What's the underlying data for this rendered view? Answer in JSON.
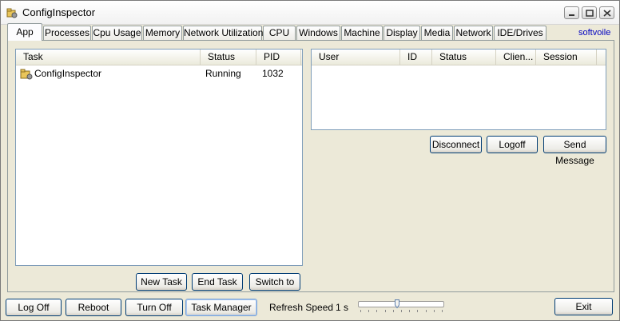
{
  "window": {
    "title": "ConfigInspector",
    "icon": "folder-gear-icon"
  },
  "tabs": [
    {
      "label": "App",
      "active": true
    },
    {
      "label": "Processes"
    },
    {
      "label": "Cpu Usage"
    },
    {
      "label": "Memory"
    },
    {
      "label": "Network Utilization"
    },
    {
      "label": "CPU"
    },
    {
      "label": "Windows"
    },
    {
      "label": "Machine"
    },
    {
      "label": "Display"
    },
    {
      "label": "Media"
    },
    {
      "label": "Network"
    },
    {
      "label": "IDE/Drives"
    }
  ],
  "brand_link": "softvoile",
  "tasks_table": {
    "columns": [
      "Task",
      "Status",
      "PID"
    ],
    "rows": [
      {
        "task": "ConfigInspector",
        "status": "Running",
        "pid": "1032",
        "icon": "app-icon"
      }
    ]
  },
  "users_table": {
    "columns": [
      "User",
      "ID",
      "Status",
      "Clien...",
      "Session"
    ],
    "rows": []
  },
  "user_actions": {
    "disconnect": "Disconnect",
    "logoff": "Logoff",
    "send_message": "Send Message"
  },
  "task_actions": {
    "new_task": "New Task",
    "end_task": "End Task",
    "switch_to": "Switch to"
  },
  "bottom_bar": {
    "log_off": "Log Off",
    "reboot": "Reboot",
    "turn_off": "Turn Off",
    "task_manager": "Task Manager",
    "refresh_label": "Refresh Speed",
    "refresh_value": "1 s",
    "refresh_level": 0.45,
    "exit": "Exit"
  },
  "colors": {
    "window_bg": "#ece9d8",
    "link": "#0000c0",
    "button_border": "#003c74"
  }
}
